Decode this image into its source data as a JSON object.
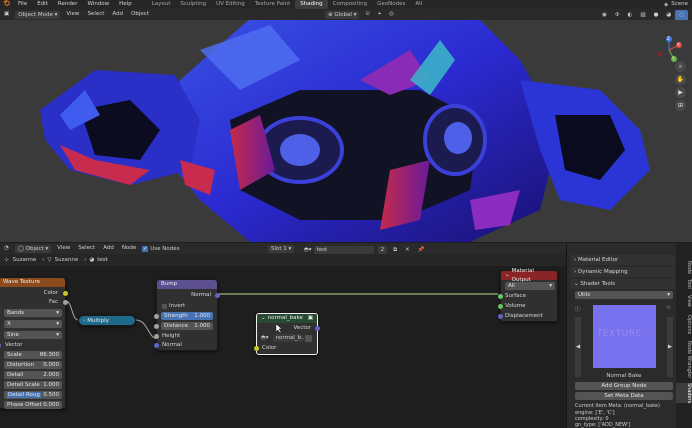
{
  "topbar": {
    "menus": [
      "File",
      "Edit",
      "Render",
      "Window",
      "Help"
    ],
    "workspaces": [
      "Layout",
      "Sculpting",
      "UV Editing",
      "Texture Paint",
      "Shading",
      "Compositing",
      "GeoNodes",
      "All"
    ],
    "active_workspace": "Shading",
    "scene": "Scene"
  },
  "viewport_header": {
    "mode": "Object Mode",
    "menus": [
      "View",
      "Select",
      "Add",
      "Object"
    ],
    "orientation": "Global"
  },
  "gizmo": {
    "x": "X",
    "y": "Y",
    "z": "Z"
  },
  "node_header": {
    "type": "Object",
    "menus": [
      "View",
      "Select",
      "Add",
      "Node"
    ],
    "use_nodes": "Use Nodes",
    "slot": "Slot 1",
    "material": "test",
    "users": "2"
  },
  "breadcrumb": {
    "object": "Suzanne",
    "mesh": "Suzanne",
    "material": "test"
  },
  "nodes": {
    "wave": {
      "title": "Wave Texture",
      "out_color": "Color",
      "out_fac": "Fac",
      "type": "Bands",
      "axis": "X",
      "profile": "Sine",
      "vector": "Vector",
      "fields": [
        {
          "label": "Scale",
          "value": "86.300"
        },
        {
          "label": "Distortion",
          "value": "0.000"
        },
        {
          "label": "Detail",
          "value": "2.000"
        },
        {
          "label": "Detail Scale",
          "value": "1.000"
        },
        {
          "label": "Detail Roug",
          "value": "0.500"
        },
        {
          "label": "Phase Offset",
          "value": "0.000"
        }
      ]
    },
    "multiply": {
      "label": "Multiply"
    },
    "bump": {
      "title": "Bump",
      "out": "Normal",
      "invert": "Invert",
      "strength_label": "Strength",
      "strength": "1.000",
      "distance_label": "Distance",
      "distance": "1.000",
      "height": "Height",
      "normal": "Normal"
    },
    "bake": {
      "title": "normal_bake",
      "out": "Vector",
      "image": "normal_b...",
      "in": "Color"
    },
    "output": {
      "title": "Material Output",
      "target": "All",
      "surface": "Surface",
      "volume": "Volume",
      "displacement": "Displacement"
    }
  },
  "sidebar": {
    "panels": [
      "Material Editor",
      "Dynamic Mapping",
      "Shader Tools"
    ],
    "utils": "Utils",
    "preview_text": "Normal Bake",
    "preview_watermark": "TEXTURE",
    "buttons": [
      "Add Group Node",
      "Set Meta Data"
    ],
    "meta": [
      "Current Item Meta: (normal_bake)",
      "engine: ['E', 'C']",
      "complexity: 0",
      "gn_type: ['ADD_NEW']"
    ]
  },
  "tabs": [
    "Node",
    "Tool",
    "View",
    "Options",
    "Node Wrangler",
    "Shaders"
  ],
  "colors": {
    "wave_header": "#8b4a1c",
    "bump_header": "#5b4f8f",
    "bake_header": "#294a32",
    "output_header": "#8b2525",
    "multiply": "#1f6a8a",
    "selected": "#f0f0f0",
    "preview_bg": "#7771ee"
  }
}
